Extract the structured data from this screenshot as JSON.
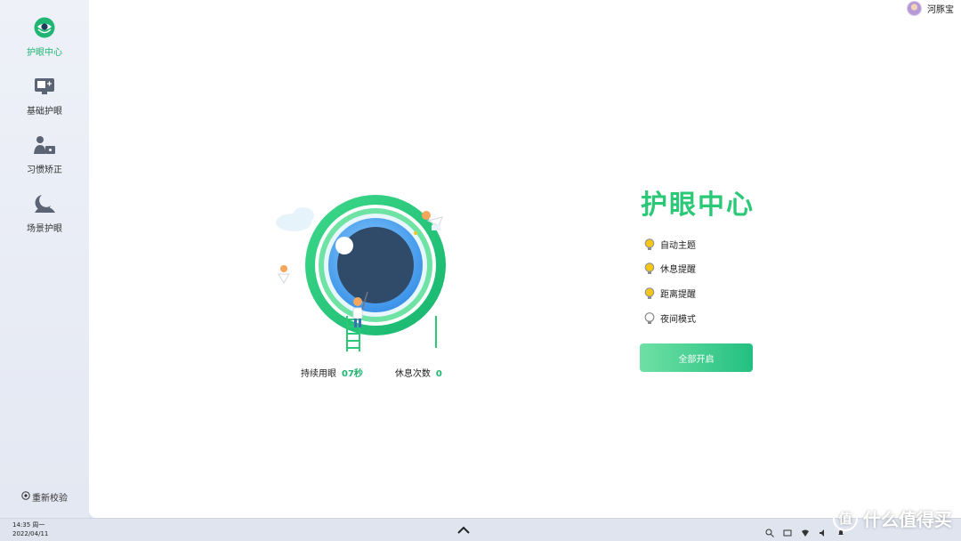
{
  "sidebar": {
    "items": [
      {
        "label": "护眼中心",
        "icon": "eye-icon",
        "active": true
      },
      {
        "label": "基础护眼",
        "icon": "monitor-icon",
        "active": false
      },
      {
        "label": "习惯矫正",
        "icon": "user-desk-icon",
        "active": false
      },
      {
        "label": "场景护眼",
        "icon": "moon-icon",
        "active": false
      }
    ],
    "recalibrate": "重新校验"
  },
  "user": {
    "name": "河豚宝"
  },
  "main": {
    "title": "护眼中心",
    "stats": [
      {
        "label": "持续用眼",
        "value": "07秒"
      },
      {
        "label": "休息次数",
        "value": "0"
      }
    ],
    "features": [
      {
        "label": "自动主题",
        "enabled": true
      },
      {
        "label": "休息提醒",
        "enabled": true
      },
      {
        "label": "距离提醒",
        "enabled": true
      },
      {
        "label": "夜间模式",
        "enabled": false
      }
    ],
    "enable_all": "全部开启"
  },
  "taskbar": {
    "time": "14:35 周一",
    "date": "2022/04/11"
  },
  "watermark": {
    "logo": "值",
    "text": "什么值得买"
  },
  "colors": {
    "accent": "#21b573",
    "bulb_on": "#f5c518",
    "bulb_off": "#888888"
  }
}
